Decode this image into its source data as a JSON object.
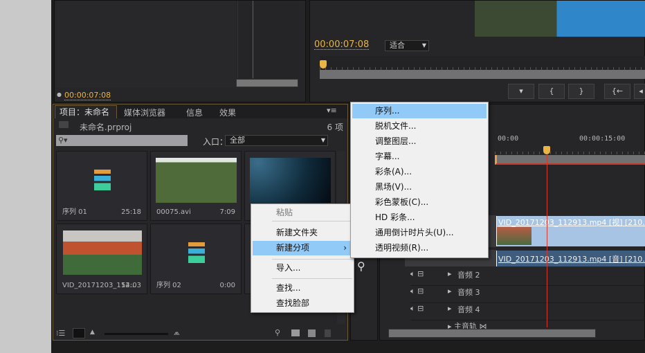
{
  "colors": {
    "accent": "#e9b545",
    "highlight": "#91c9f7",
    "playhead": "#d43a2a",
    "video_clip": "#a7c4e4",
    "audio_clip": "#3d5c7e"
  },
  "source_monitor": {
    "timecode": "00:00:07:08"
  },
  "program_monitor": {
    "timecode": "00:00:07:08",
    "zoom_select": "适合",
    "buttons": [
      "marker-icon",
      "mark-in-icon",
      "mark-out-icon",
      "go-to-in-icon"
    ]
  },
  "project": {
    "tabs": [
      "项目：未命名",
      "媒体浏览器",
      "信息",
      "效果"
    ],
    "file": "未命名.prproj",
    "count": "6 项",
    "search_placeholder": "",
    "entry_label": "入口：",
    "entry_value": "全部",
    "items": [
      {
        "name": "序列 01",
        "duration": "25:18",
        "type": "sequence"
      },
      {
        "name": "00075.avi",
        "duration": "7:09",
        "type": "video"
      },
      {
        "name": "",
        "duration": "",
        "type": "video"
      },
      {
        "name": "VID_20171203_112...",
        "duration": "54:03",
        "type": "video"
      },
      {
        "name": "序列 02",
        "duration": "0:00",
        "type": "sequence"
      }
    ]
  },
  "context_menu": {
    "items": [
      "粘贴",
      "新建文件夹",
      "新建分项",
      "导入...",
      "查找...",
      "查找脸部"
    ]
  },
  "submenu": {
    "items": [
      "序列...",
      "脱机文件...",
      "调整图层...",
      "字幕...",
      "彩条(A)...",
      "黑场(V)...",
      "彩色蒙板(C)...",
      "HD 彩条...",
      "通用倒计时片头(U)...",
      "透明视频(R)..."
    ]
  },
  "timeline": {
    "ruler": [
      "00:00",
      "00:00:15:00"
    ],
    "video_clip": "VID_20171203_112913.mp4 [视] [210.41%]",
    "audio_clip": "VID_20171203_112913.mp4 [音] [210.41%]",
    "tracks": [
      {
        "name": "音频",
        "num": "2"
      },
      {
        "name": "音频",
        "num": "3"
      },
      {
        "name": "音频",
        "num": "4"
      }
    ],
    "master": "主音轨"
  }
}
